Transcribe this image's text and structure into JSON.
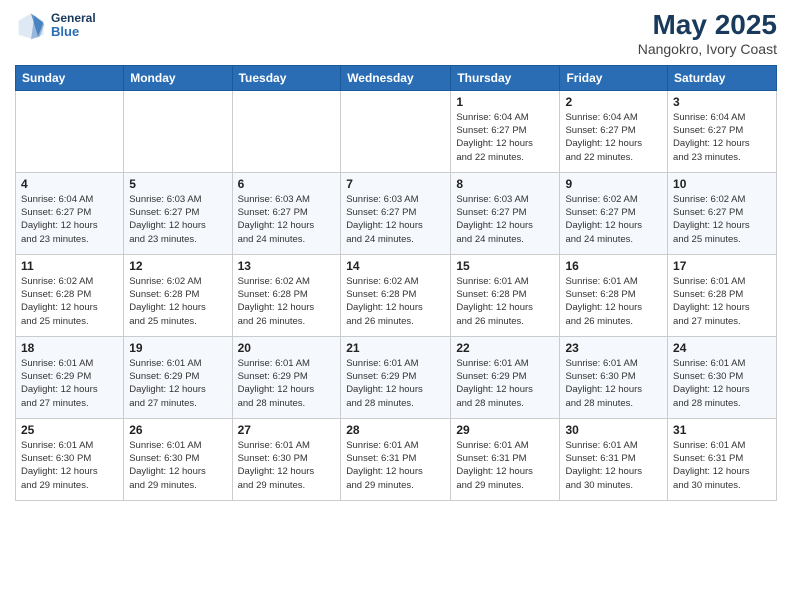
{
  "header": {
    "logo_general": "General",
    "logo_blue": "Blue",
    "title": "May 2025",
    "subtitle": "Nangokro, Ivory Coast"
  },
  "days_of_week": [
    "Sunday",
    "Monday",
    "Tuesday",
    "Wednesday",
    "Thursday",
    "Friday",
    "Saturday"
  ],
  "weeks": [
    {
      "days": [
        {
          "num": "",
          "info": ""
        },
        {
          "num": "",
          "info": ""
        },
        {
          "num": "",
          "info": ""
        },
        {
          "num": "",
          "info": ""
        },
        {
          "num": "1",
          "info": "Sunrise: 6:04 AM\nSunset: 6:27 PM\nDaylight: 12 hours\nand 22 minutes."
        },
        {
          "num": "2",
          "info": "Sunrise: 6:04 AM\nSunset: 6:27 PM\nDaylight: 12 hours\nand 22 minutes."
        },
        {
          "num": "3",
          "info": "Sunrise: 6:04 AM\nSunset: 6:27 PM\nDaylight: 12 hours\nand 23 minutes."
        }
      ]
    },
    {
      "days": [
        {
          "num": "4",
          "info": "Sunrise: 6:04 AM\nSunset: 6:27 PM\nDaylight: 12 hours\nand 23 minutes."
        },
        {
          "num": "5",
          "info": "Sunrise: 6:03 AM\nSunset: 6:27 PM\nDaylight: 12 hours\nand 23 minutes."
        },
        {
          "num": "6",
          "info": "Sunrise: 6:03 AM\nSunset: 6:27 PM\nDaylight: 12 hours\nand 24 minutes."
        },
        {
          "num": "7",
          "info": "Sunrise: 6:03 AM\nSunset: 6:27 PM\nDaylight: 12 hours\nand 24 minutes."
        },
        {
          "num": "8",
          "info": "Sunrise: 6:03 AM\nSunset: 6:27 PM\nDaylight: 12 hours\nand 24 minutes."
        },
        {
          "num": "9",
          "info": "Sunrise: 6:02 AM\nSunset: 6:27 PM\nDaylight: 12 hours\nand 24 minutes."
        },
        {
          "num": "10",
          "info": "Sunrise: 6:02 AM\nSunset: 6:27 PM\nDaylight: 12 hours\nand 25 minutes."
        }
      ]
    },
    {
      "days": [
        {
          "num": "11",
          "info": "Sunrise: 6:02 AM\nSunset: 6:28 PM\nDaylight: 12 hours\nand 25 minutes."
        },
        {
          "num": "12",
          "info": "Sunrise: 6:02 AM\nSunset: 6:28 PM\nDaylight: 12 hours\nand 25 minutes."
        },
        {
          "num": "13",
          "info": "Sunrise: 6:02 AM\nSunset: 6:28 PM\nDaylight: 12 hours\nand 26 minutes."
        },
        {
          "num": "14",
          "info": "Sunrise: 6:02 AM\nSunset: 6:28 PM\nDaylight: 12 hours\nand 26 minutes."
        },
        {
          "num": "15",
          "info": "Sunrise: 6:01 AM\nSunset: 6:28 PM\nDaylight: 12 hours\nand 26 minutes."
        },
        {
          "num": "16",
          "info": "Sunrise: 6:01 AM\nSunset: 6:28 PM\nDaylight: 12 hours\nand 26 minutes."
        },
        {
          "num": "17",
          "info": "Sunrise: 6:01 AM\nSunset: 6:28 PM\nDaylight: 12 hours\nand 27 minutes."
        }
      ]
    },
    {
      "days": [
        {
          "num": "18",
          "info": "Sunrise: 6:01 AM\nSunset: 6:29 PM\nDaylight: 12 hours\nand 27 minutes."
        },
        {
          "num": "19",
          "info": "Sunrise: 6:01 AM\nSunset: 6:29 PM\nDaylight: 12 hours\nand 27 minutes."
        },
        {
          "num": "20",
          "info": "Sunrise: 6:01 AM\nSunset: 6:29 PM\nDaylight: 12 hours\nand 28 minutes."
        },
        {
          "num": "21",
          "info": "Sunrise: 6:01 AM\nSunset: 6:29 PM\nDaylight: 12 hours\nand 28 minutes."
        },
        {
          "num": "22",
          "info": "Sunrise: 6:01 AM\nSunset: 6:29 PM\nDaylight: 12 hours\nand 28 minutes."
        },
        {
          "num": "23",
          "info": "Sunrise: 6:01 AM\nSunset: 6:30 PM\nDaylight: 12 hours\nand 28 minutes."
        },
        {
          "num": "24",
          "info": "Sunrise: 6:01 AM\nSunset: 6:30 PM\nDaylight: 12 hours\nand 28 minutes."
        }
      ]
    },
    {
      "days": [
        {
          "num": "25",
          "info": "Sunrise: 6:01 AM\nSunset: 6:30 PM\nDaylight: 12 hours\nand 29 minutes."
        },
        {
          "num": "26",
          "info": "Sunrise: 6:01 AM\nSunset: 6:30 PM\nDaylight: 12 hours\nand 29 minutes."
        },
        {
          "num": "27",
          "info": "Sunrise: 6:01 AM\nSunset: 6:30 PM\nDaylight: 12 hours\nand 29 minutes."
        },
        {
          "num": "28",
          "info": "Sunrise: 6:01 AM\nSunset: 6:31 PM\nDaylight: 12 hours\nand 29 minutes."
        },
        {
          "num": "29",
          "info": "Sunrise: 6:01 AM\nSunset: 6:31 PM\nDaylight: 12 hours\nand 29 minutes."
        },
        {
          "num": "30",
          "info": "Sunrise: 6:01 AM\nSunset: 6:31 PM\nDaylight: 12 hours\nand 30 minutes."
        },
        {
          "num": "31",
          "info": "Sunrise: 6:01 AM\nSunset: 6:31 PM\nDaylight: 12 hours\nand 30 minutes."
        }
      ]
    }
  ]
}
